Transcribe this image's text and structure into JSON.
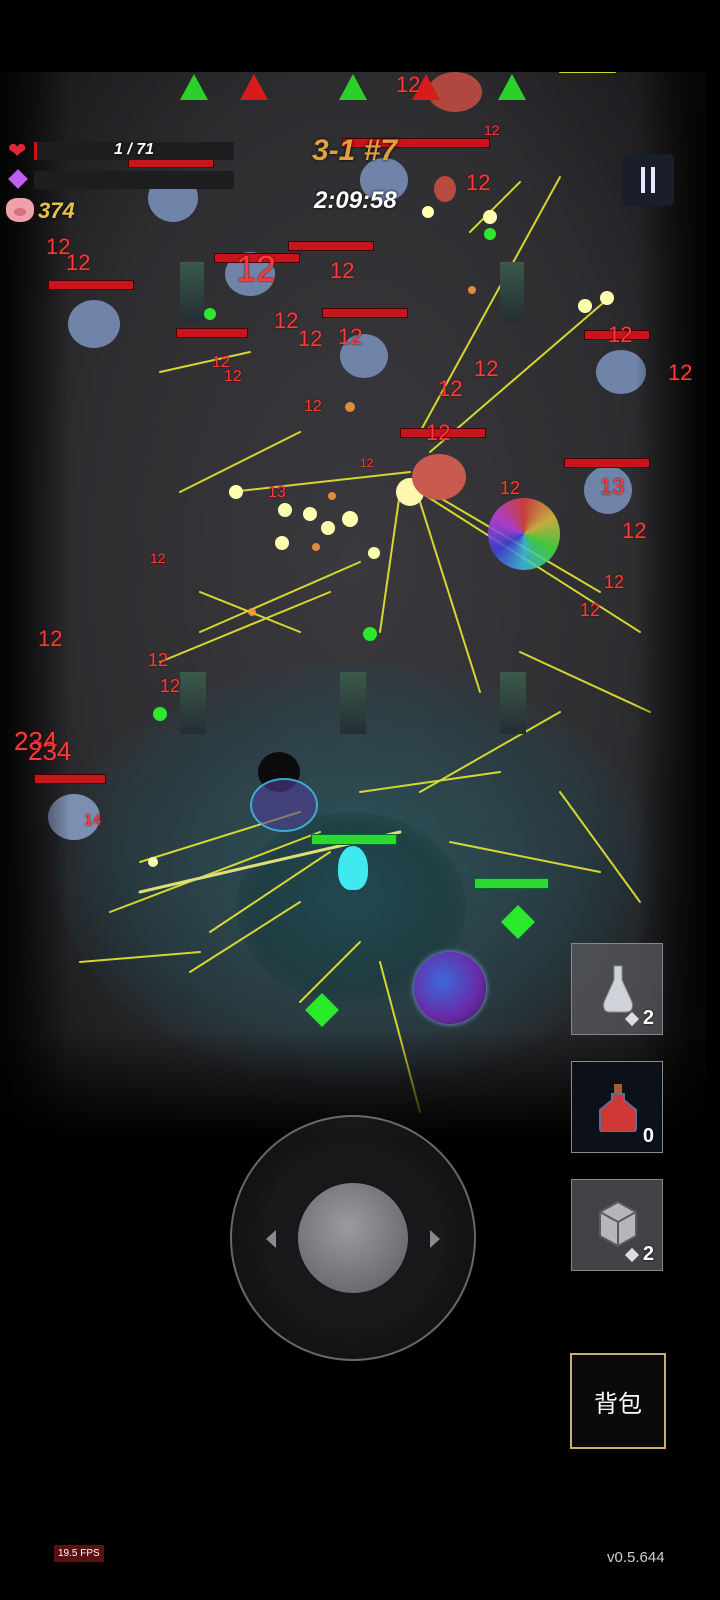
{
  "hud": {
    "hp_text": "1 / 71",
    "hp_fraction": 0.014,
    "xp_fraction": 0.0,
    "coins": "374",
    "stage": "3-1 #7",
    "timer": "2:09:58",
    "icons": {
      "hp": "heart-icon",
      "xp": "purple-gem-icon",
      "coins": "pig-icon",
      "pause": "pause-icon"
    },
    "colors": {
      "hp": "#c8141c",
      "stage": "#e0a040",
      "gold": "#e8c04a",
      "xp": "#b050e0"
    }
  },
  "damage_numbers": [
    "12",
    "12",
    "12",
    "12",
    "12",
    "12",
    "12",
    "12",
    "12",
    "12",
    "12",
    "12",
    "12",
    "12",
    "13",
    "13",
    "14",
    "234",
    "234",
    "12",
    "12",
    "12",
    "12",
    "12",
    "12",
    "12",
    "12",
    "12",
    "12",
    "12",
    "12",
    "12"
  ],
  "items": [
    {
      "name": "potion-empty",
      "icon": "flask-icon",
      "count": "2",
      "has_gem": true
    },
    {
      "name": "potion-red",
      "icon": "red-potion-icon",
      "count": "0",
      "has_gem": false
    },
    {
      "name": "scroll-box",
      "icon": "rune-box-icon",
      "count": "2",
      "has_gem": true
    }
  ],
  "bag": {
    "label": "背包"
  },
  "footer": {
    "fps": "19.5 FPS",
    "version": "v0.5.644"
  },
  "ally_health": {
    "player_fraction": 1.0,
    "turret_fraction": 0.85
  }
}
